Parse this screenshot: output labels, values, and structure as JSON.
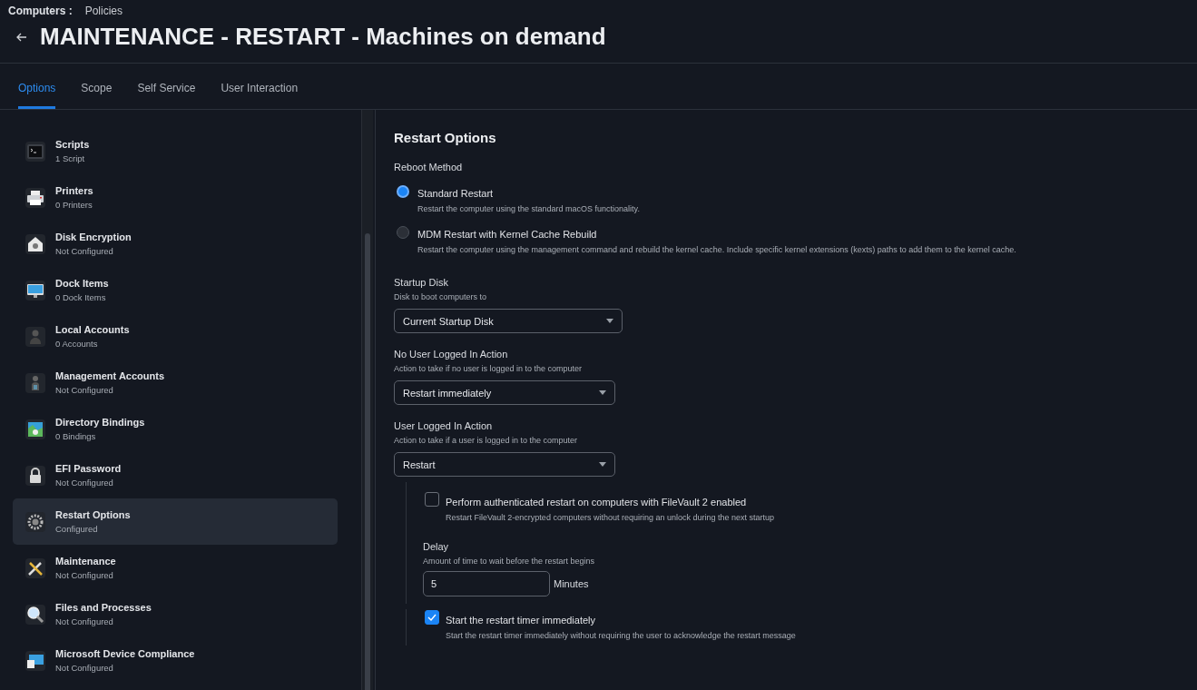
{
  "breadcrumb": {
    "section": "Computers :",
    "page": "Policies"
  },
  "title": "MAINTENANCE - RESTART - Machines on demand",
  "tabs": [
    {
      "label": "Options",
      "selected": true
    },
    {
      "label": "Scope",
      "selected": false
    },
    {
      "label": "Self Service",
      "selected": false
    },
    {
      "label": "User Interaction",
      "selected": false
    }
  ],
  "sidebar": {
    "items": [
      {
        "title": "Scripts",
        "status": "1 Script",
        "selected": false
      },
      {
        "title": "Printers",
        "status": "0 Printers",
        "selected": false
      },
      {
        "title": "Disk Encryption",
        "status": "Not Configured",
        "selected": false
      },
      {
        "title": "Dock Items",
        "status": "0 Dock Items",
        "selected": false
      },
      {
        "title": "Local Accounts",
        "status": "0 Accounts",
        "selected": false
      },
      {
        "title": "Management Accounts",
        "status": "Not Configured",
        "selected": false
      },
      {
        "title": "Directory Bindings",
        "status": "0 Bindings",
        "selected": false
      },
      {
        "title": "EFI Password",
        "status": "Not Configured",
        "selected": false
      },
      {
        "title": "Restart Options",
        "status": "Configured",
        "selected": true
      },
      {
        "title": "Maintenance",
        "status": "Not Configured",
        "selected": false
      },
      {
        "title": "Files and Processes",
        "status": "Not Configured",
        "selected": false
      },
      {
        "title": "Microsoft Device Compliance",
        "status": "Not Configured",
        "selected": false
      }
    ]
  },
  "panel": {
    "heading": "Restart Options",
    "reboot_method": {
      "label": "Reboot Method",
      "options": [
        {
          "label": "Standard Restart",
          "description": "Restart the computer using the standard macOS functionality.",
          "selected": true
        },
        {
          "label": "MDM Restart with Kernel Cache Rebuild",
          "description": "Restart the computer using the management command and rebuild the kernel cache. Include specific kernel extensions (kexts) paths to add them to the kernel cache.",
          "selected": false
        }
      ]
    },
    "selects": [
      {
        "label": "Startup Disk",
        "hint": "Disk to boot computers to",
        "value": "Current Startup Disk"
      },
      {
        "label": "No User Logged In Action",
        "hint": "Action to take if no user is logged in to the computer",
        "value": "Restart immediately"
      },
      {
        "label": "User Logged In Action",
        "hint": "Action to take if a user is logged in to the computer",
        "value": "Restart"
      }
    ],
    "filevault": {
      "label": "Perform authenticated restart on computers with FileVault 2 enabled",
      "description": "Restart FileVault 2-encrypted computers without requiring an unlock during the next startup",
      "checked": false
    },
    "delay": {
      "label": "Delay",
      "hint": "Amount of time to wait before the restart begins",
      "value": "5",
      "unit": "Minutes"
    },
    "timer": {
      "label": "Start the restart timer immediately",
      "description": "Start the restart timer immediately without requiring the user to acknowledge the restart message",
      "checked": true
    }
  }
}
